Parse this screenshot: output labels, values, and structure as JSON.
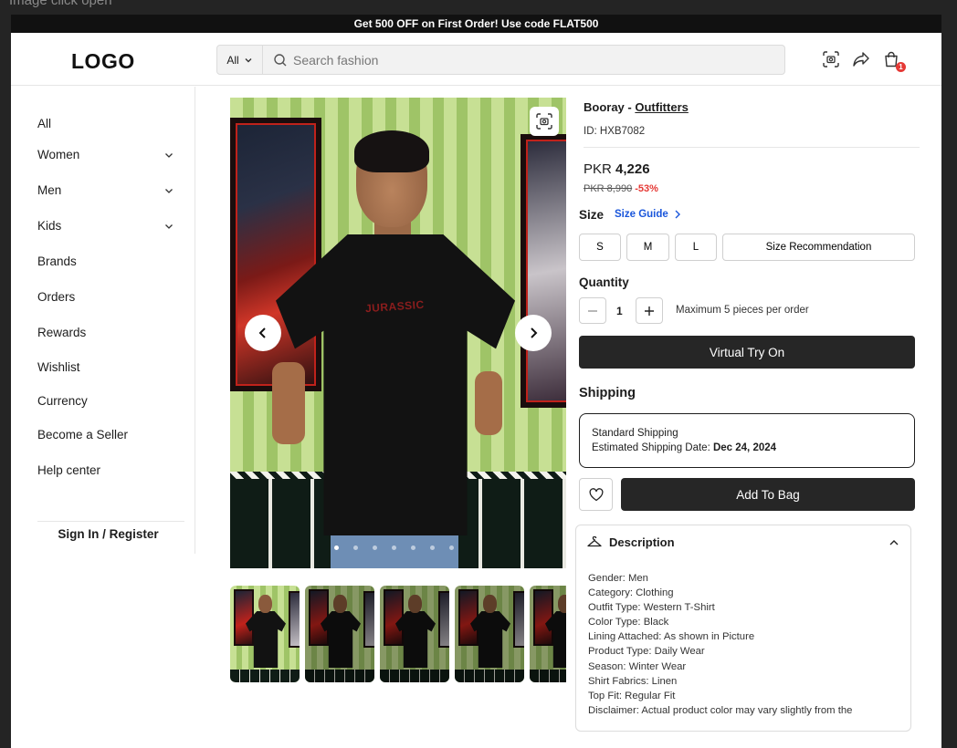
{
  "frame_caption": "Image click open",
  "announcement": "Get 500 OFF on First Order! Use code FLAT500",
  "header": {
    "logo": "LOGO",
    "search_category": "All",
    "search_placeholder": "Search fashion",
    "cart_count": "1"
  },
  "sidebar": {
    "items": [
      {
        "label": "All",
        "has_chevron": false
      },
      {
        "label": "Women",
        "has_chevron": true
      },
      {
        "label": "Men",
        "has_chevron": true
      },
      {
        "label": "Kids",
        "has_chevron": true
      },
      {
        "label": "Brands",
        "has_chevron": false
      },
      {
        "label": "Orders",
        "has_chevron": false
      },
      {
        "label": "Rewards",
        "has_chevron": false
      },
      {
        "label": "Wishlist",
        "has_chevron": false
      },
      {
        "label": "Currency",
        "has_chevron": false
      },
      {
        "label": "Become a Seller",
        "has_chevron": false
      },
      {
        "label": "Help center",
        "has_chevron": false
      }
    ],
    "sign_in": "Sign In / Register"
  },
  "gallery": {
    "shirt_print": "JURASSIC",
    "slide_count": 7,
    "active_slide": 1,
    "thumbnail_count": 5
  },
  "product": {
    "brand": "Booray",
    "brand_separator": " - ",
    "seller": "Outfitters",
    "id_text": "ID: HXB7082",
    "currency": "PKR",
    "price": "4,226",
    "old_price": "PKR 8,990",
    "discount": "-53%",
    "size_label": "Size",
    "size_guide": "Size Guide",
    "sizes": [
      "S",
      "M",
      "L"
    ],
    "size_recommendation": "Size Recommendation",
    "quantity_label": "Quantity",
    "quantity": "1",
    "quantity_note": "Maximum 5 pieces per order",
    "try_on": "Virtual Try On",
    "shipping_title": "Shipping",
    "shipping_method": "Standard Shipping",
    "shipping_est_label": "Estimated Shipping Date: ",
    "shipping_date": "Dec 24, 2024",
    "add_to_bag": "Add To Bag",
    "description_title": "Description",
    "description_lines": [
      "Gender: Men",
      "Category: Clothing",
      "Outfit Type: Western T-Shirt",
      "Color Type: Black",
      "Lining Attached: As shown in Picture",
      "Product Type: Daily Wear",
      "Season: Winter Wear",
      "Shirt Fabrics: Linen",
      "Top Fit: Regular Fit",
      "Disclaimer: Actual product color may vary slightly from the"
    ]
  },
  "colors": {
    "accent_link": "#1a56db",
    "discount": "#e53935",
    "button_dark": "#262626",
    "announcement_bg": "#111111"
  }
}
